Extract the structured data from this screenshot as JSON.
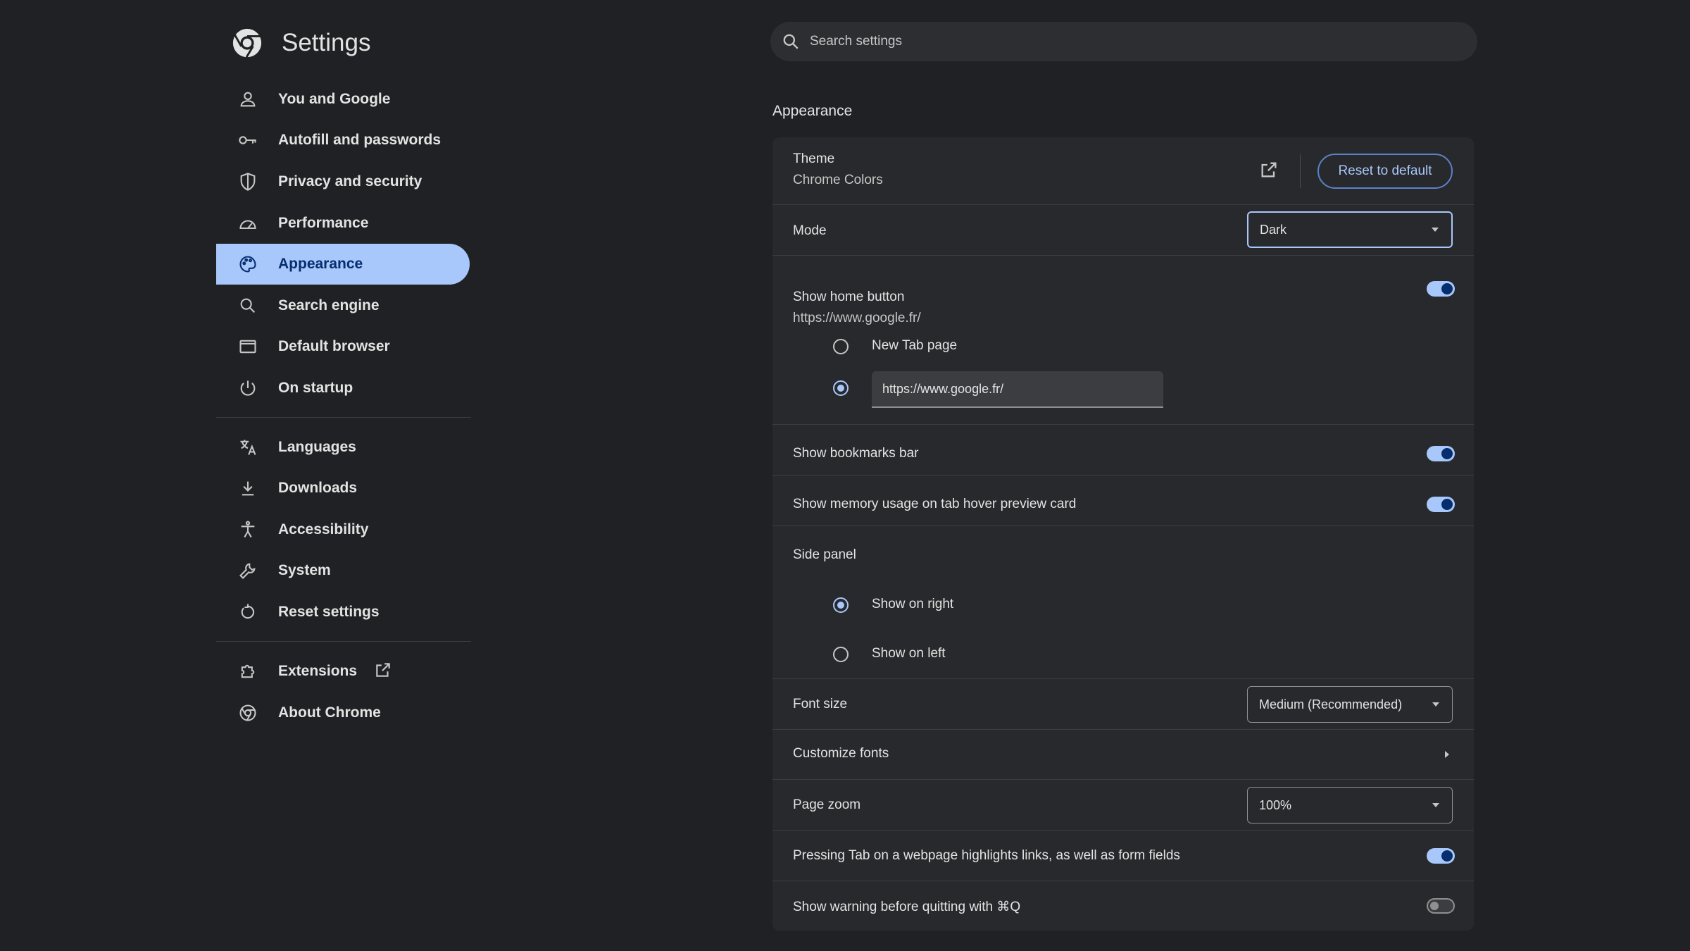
{
  "app": {
    "title": "Settings"
  },
  "search": {
    "placeholder": "Search settings"
  },
  "sidebar": {
    "items": [
      {
        "label": "You and Google",
        "icon": "person-icon"
      },
      {
        "label": "Autofill and passwords",
        "icon": "key-icon"
      },
      {
        "label": "Privacy and security",
        "icon": "shield-icon"
      },
      {
        "label": "Performance",
        "icon": "speedometer-icon"
      },
      {
        "label": "Appearance",
        "icon": "palette-icon",
        "active": true
      },
      {
        "label": "Search engine",
        "icon": "search-icon"
      },
      {
        "label": "Default browser",
        "icon": "browser-window-icon"
      },
      {
        "label": "On startup",
        "icon": "power-icon"
      },
      {
        "label": "Languages",
        "icon": "translate-icon"
      },
      {
        "label": "Downloads",
        "icon": "download-icon"
      },
      {
        "label": "Accessibility",
        "icon": "accessibility-icon"
      },
      {
        "label": "System",
        "icon": "wrench-icon"
      },
      {
        "label": "Reset settings",
        "icon": "reset-icon"
      },
      {
        "label": "Extensions",
        "icon": "puzzle-icon"
      },
      {
        "label": "About Chrome",
        "icon": "chrome-icon"
      }
    ]
  },
  "appearance": {
    "section_title": "Appearance",
    "theme": {
      "label": "Theme",
      "value": "Chrome Colors",
      "reset_label": "Reset to default"
    },
    "mode": {
      "label": "Mode",
      "value": "Dark"
    },
    "home_button": {
      "label": "Show home button",
      "url": "https://www.google.fr/",
      "enabled": true,
      "option_new_tab": "New Tab page",
      "custom_url_value": "https://www.google.fr/"
    },
    "bookmarks_bar": {
      "label": "Show bookmarks bar",
      "enabled": true
    },
    "memory_usage": {
      "label": "Show memory usage on tab hover preview card",
      "enabled": true
    },
    "side_panel": {
      "label": "Side panel",
      "option_right": "Show on right",
      "option_left": "Show on left",
      "selected": "Show on right"
    },
    "font_size": {
      "label": "Font size",
      "value": "Medium (Recommended)"
    },
    "customize_fonts": {
      "label": "Customize fonts"
    },
    "page_zoom": {
      "label": "Page zoom",
      "value": "100%"
    },
    "tab_highlight": {
      "label": "Pressing Tab on a webpage highlights links, as well as form fields",
      "enabled": true
    },
    "quit_warning": {
      "label": "Show warning before quitting with ⌘Q",
      "enabled": false
    }
  },
  "colors": {
    "background": "#202124",
    "card": "#28292c",
    "accent": "#a8c7fa",
    "active_text": "#062e6f"
  }
}
